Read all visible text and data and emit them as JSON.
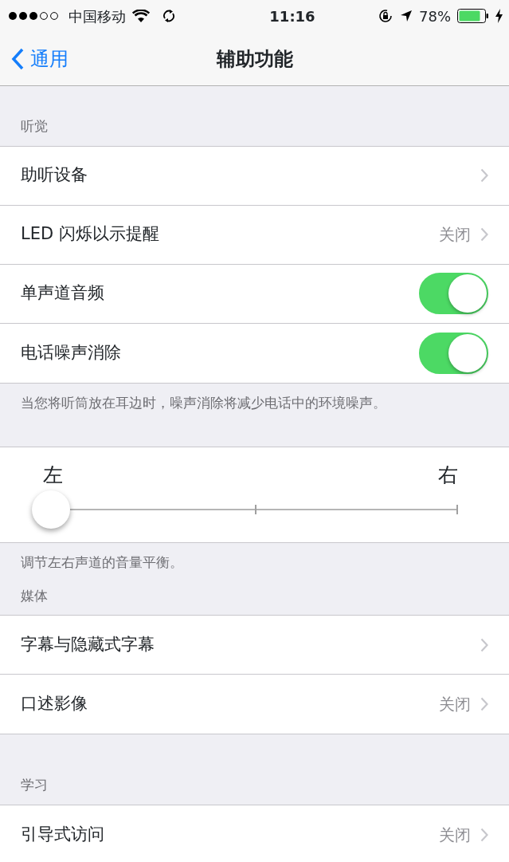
{
  "status_bar": {
    "carrier": "中国移动",
    "time": "11:16",
    "battery": "78%"
  },
  "nav": {
    "back": "通用",
    "title": "辅助功能"
  },
  "sections": [
    {
      "kind": "group",
      "header": "听觉",
      "rows": [
        {
          "kind": "link",
          "label": "助听设备"
        },
        {
          "kind": "link",
          "label": "LED 闪烁以示提醒",
          "value": "关闭"
        },
        {
          "kind": "switch",
          "label": "单声道音频",
          "on": true
        },
        {
          "kind": "switch",
          "label": "电话噪声消除",
          "on": true
        }
      ],
      "footer": "当您将听筒放在耳边时，噪声消除将减少电话中的环境噪声。"
    },
    {
      "kind": "slider",
      "left": "左",
      "right": "右",
      "level": 0,
      "footer": "调节左右声道的音量平衡。"
    },
    {
      "kind": "group",
      "header": "媒体",
      "rows": [
        {
          "kind": "link",
          "label": "字幕与隐藏式字幕"
        },
        {
          "kind": "link",
          "label": "口述影像",
          "value": "关闭"
        }
      ]
    },
    {
      "kind": "group",
      "header": "学习",
      "rows": [
        {
          "kind": "link",
          "label": "引导式访问",
          "value": "关闭"
        }
      ]
    }
  ]
}
